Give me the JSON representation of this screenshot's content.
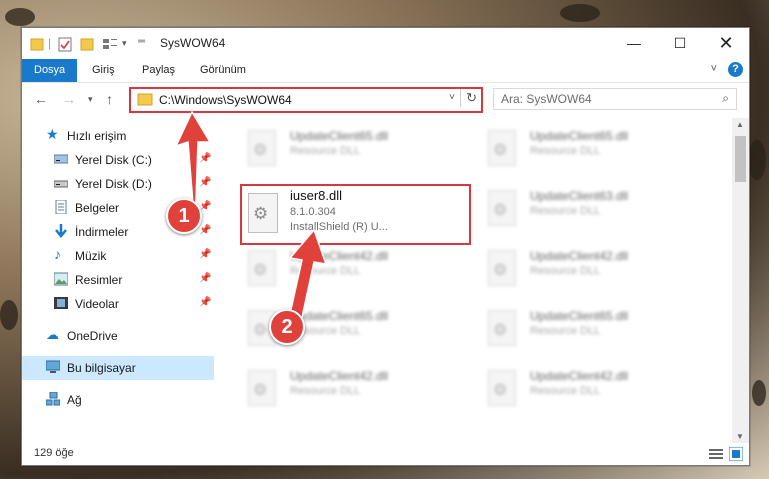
{
  "window": {
    "title": "SysWOW64"
  },
  "ribbon": {
    "tabs": [
      "Dosya",
      "Giriş",
      "Paylaş",
      "Görünüm"
    ]
  },
  "address": {
    "path": "C:\\Windows\\SysWOW64"
  },
  "search": {
    "placeholder": "Ara: SysWOW64"
  },
  "sidebar": {
    "items": [
      {
        "label": "Hızlı erişim",
        "icon": "star-icon"
      },
      {
        "label": "Yerel Disk (C:)",
        "icon": "drive-icon",
        "pinned": true
      },
      {
        "label": "Yerel Disk (D:)",
        "icon": "drive-icon",
        "pinned": true
      },
      {
        "label": "Belgeler",
        "icon": "documents-icon",
        "pinned": true
      },
      {
        "label": "İndirmeler",
        "icon": "download-icon",
        "pinned": true
      },
      {
        "label": "Müzik",
        "icon": "music-icon",
        "pinned": true
      },
      {
        "label": "Resimler",
        "icon": "pictures-icon",
        "pinned": true
      },
      {
        "label": "Videolar",
        "icon": "videos-icon",
        "pinned": true
      },
      {
        "label": "OneDrive",
        "icon": "cloud-icon"
      },
      {
        "label": "Bu bilgisayar",
        "icon": "computer-icon",
        "selected": true
      },
      {
        "label": "Ağ",
        "icon": "network-icon"
      }
    ]
  },
  "files": {
    "highlighted": {
      "name": "iuser8.dll",
      "version": "8.1.0.304",
      "description": "InstallShield (R) U..."
    },
    "blurred": [
      {
        "name": "UpdateClient65.dll",
        "desc": "Resource DLL"
      },
      {
        "name": "UpdateClient65.dll",
        "desc": "Resource DLL"
      },
      {
        "name": "UpdateClient63.dll",
        "desc": "Resource DLL"
      },
      {
        "name": "UpdateClient42.dll",
        "desc": "Resource DLL"
      },
      {
        "name": "UpdateClient42.dll",
        "desc": "Resource DLL"
      },
      {
        "name": "UpdateClient65.dll",
        "desc": "Resource DLL"
      },
      {
        "name": "UpdateClient65.dll",
        "desc": "Resource DLL"
      },
      {
        "name": "UpdateClient42.dll",
        "desc": "Resource DLL"
      },
      {
        "name": "UpdateClient42.dll",
        "desc": "Resource DLL"
      }
    ]
  },
  "status": {
    "count": "129 öğe"
  },
  "callouts": [
    "1",
    "2"
  ],
  "colors": {
    "accent": "#1979ca",
    "highlight": "#d9373f",
    "selected": "#cce8ff"
  }
}
